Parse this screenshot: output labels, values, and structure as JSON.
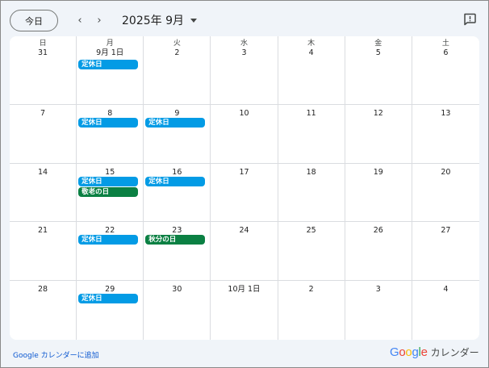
{
  "colors": {
    "holiday_event": "#0b8043",
    "closed_event": "#039be5",
    "logo": [
      "#4285f4",
      "#ea4335",
      "#fbbc05",
      "#4285f4",
      "#34a853",
      "#ea4335"
    ]
  },
  "toolbar": {
    "today_label": "今日",
    "prev_icon": "‹",
    "next_icon": "›",
    "month_label": "2025年 9月",
    "feedback_icon": "feedback-icon"
  },
  "calendar": {
    "weekdays": [
      "日",
      "月",
      "火",
      "水",
      "木",
      "金",
      "土"
    ],
    "weeks": [
      [
        {
          "label": "31",
          "events": []
        },
        {
          "label": "9月 1日",
          "events": [
            {
              "title": "定休日",
              "kind": "closed_event"
            }
          ]
        },
        {
          "label": "2",
          "events": []
        },
        {
          "label": "3",
          "events": []
        },
        {
          "label": "4",
          "events": []
        },
        {
          "label": "5",
          "events": []
        },
        {
          "label": "6",
          "events": []
        }
      ],
      [
        {
          "label": "7",
          "events": []
        },
        {
          "label": "8",
          "events": [
            {
              "title": "定休日",
              "kind": "closed_event"
            }
          ]
        },
        {
          "label": "9",
          "events": [
            {
              "title": "定休日",
              "kind": "closed_event"
            }
          ]
        },
        {
          "label": "10",
          "events": []
        },
        {
          "label": "11",
          "events": []
        },
        {
          "label": "12",
          "events": []
        },
        {
          "label": "13",
          "events": []
        }
      ],
      [
        {
          "label": "14",
          "events": []
        },
        {
          "label": "15",
          "events": [
            {
              "title": "定休日",
              "kind": "closed_event"
            },
            {
              "title": "敬老の日",
              "kind": "holiday_event"
            }
          ]
        },
        {
          "label": "16",
          "events": [
            {
              "title": "定休日",
              "kind": "closed_event"
            }
          ]
        },
        {
          "label": "17",
          "events": []
        },
        {
          "label": "18",
          "events": []
        },
        {
          "label": "19",
          "events": []
        },
        {
          "label": "20",
          "events": []
        }
      ],
      [
        {
          "label": "21",
          "events": []
        },
        {
          "label": "22",
          "events": [
            {
              "title": "定休日",
              "kind": "closed_event"
            }
          ]
        },
        {
          "label": "23",
          "events": [
            {
              "title": "秋分の日",
              "kind": "holiday_event"
            }
          ]
        },
        {
          "label": "24",
          "events": []
        },
        {
          "label": "25",
          "events": []
        },
        {
          "label": "26",
          "events": []
        },
        {
          "label": "27",
          "events": []
        }
      ],
      [
        {
          "label": "28",
          "events": []
        },
        {
          "label": "29",
          "events": [
            {
              "title": "定休日",
              "kind": "closed_event"
            }
          ]
        },
        {
          "label": "30",
          "events": []
        },
        {
          "label": "10月 1日",
          "events": []
        },
        {
          "label": "2",
          "events": []
        },
        {
          "label": "3",
          "events": []
        },
        {
          "label": "4",
          "events": []
        }
      ]
    ]
  },
  "footer": {
    "add_link": "Google カレンダーに追加",
    "logo_letters": [
      "G",
      "o",
      "o",
      "g",
      "l",
      "e"
    ],
    "product_name": "カレンダー"
  }
}
